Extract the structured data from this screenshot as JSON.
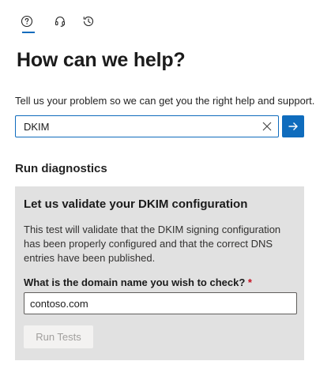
{
  "tabs": [
    {
      "icon": "help-circle-icon",
      "active": true
    },
    {
      "icon": "headset-icon",
      "active": false
    },
    {
      "icon": "history-icon",
      "active": false
    }
  ],
  "header": {
    "title": "How can we help?"
  },
  "search": {
    "description": "Tell us your problem so we can get you the right help and support.",
    "value": "DKIM"
  },
  "diagnostics": {
    "section_title": "Run diagnostics",
    "card_title": "Let us validate your DKIM configuration",
    "card_text": "This test will validate that the DKIM signing configuration has been properly configured and that the correct DNS entries have been published.",
    "field_label": "What is the domain name you wish to check?",
    "required_marker": "*",
    "field_value": "contoso.com",
    "run_button": "Run Tests"
  },
  "colors": {
    "accent": "#0f6cbd",
    "card_bg": "#e1e1e1",
    "required": "#c50f1f"
  }
}
